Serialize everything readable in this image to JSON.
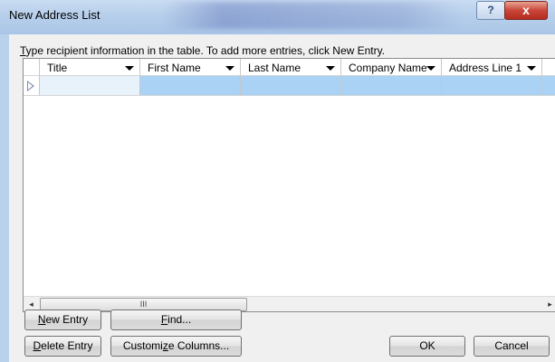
{
  "window": {
    "title": "New Address List",
    "help_label": "?",
    "close_label": "x"
  },
  "instruction": {
    "underlined": "T",
    "rest": "ype recipient information in the table.  To add more entries, click New Entry."
  },
  "table": {
    "columns": [
      {
        "label": "Title"
      },
      {
        "label": "First Name"
      },
      {
        "label": "Last Name"
      },
      {
        "label": "Company Name"
      },
      {
        "label": "Address Line 1"
      }
    ],
    "rows": [
      {
        "cells": [
          "",
          "",
          "",
          "",
          ""
        ]
      }
    ]
  },
  "scrollbar": {
    "left_arrow": "◂",
    "right_arrow": "▸",
    "thumb_grip": "III"
  },
  "buttons": {
    "new_entry": {
      "u": "N",
      "rest": "ew Entry"
    },
    "find": {
      "pre": "",
      "u": "F",
      "rest": "ind..."
    },
    "delete_entry": {
      "u": "D",
      "rest": "elete Entry"
    },
    "customize": {
      "pre": "Customi",
      "u": "z",
      "rest": "e Columns..."
    },
    "ok": "OK",
    "cancel": "Cancel"
  }
}
